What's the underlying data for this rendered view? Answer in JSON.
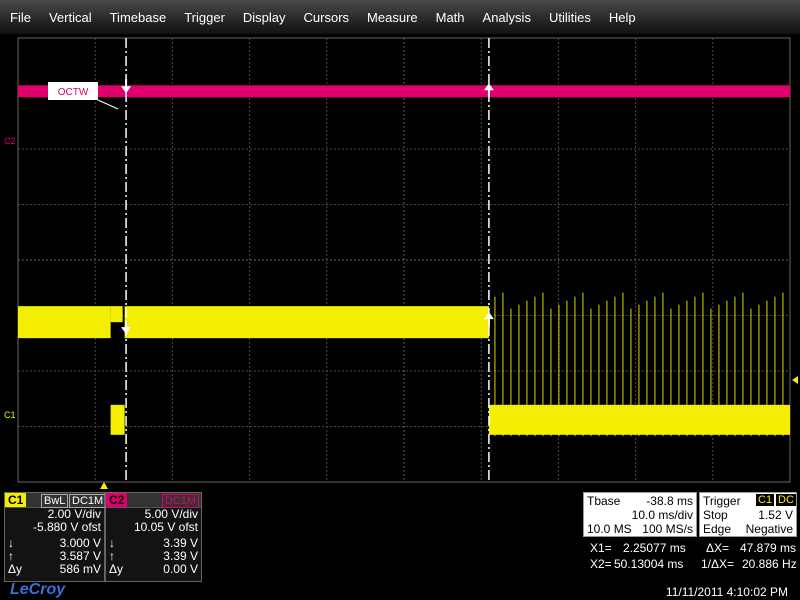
{
  "menu": [
    "File",
    "Vertical",
    "Timebase",
    "Trigger",
    "Display",
    "Cursors",
    "Measure",
    "Math",
    "Analysis",
    "Utilities",
    "Help"
  ],
  "colors": {
    "c1": "#f4ef00",
    "c2": "#e0006c",
    "grid": "#5a5a5a",
    "cursor": "#ffffff"
  },
  "waveform": {
    "annotation": "OCTW",
    "labels": {
      "c1": "C1",
      "c2": "C2"
    },
    "c2_level": 0.12,
    "c1_high": 0.64,
    "c1_low": 0.86,
    "cursor1_x": 0.14,
    "cursor2_x": 0.61,
    "glitch_x": 0.12
  },
  "ch1": {
    "tag": "C1",
    "badge1": "BwL",
    "badge2": "DC1M",
    "vdiv": "2.00 V/div",
    "ofst": "-5.880 V ofst",
    "down_val": "3.000 V",
    "up_val": "3.587 V",
    "dy_label": "Δy",
    "dy_val": "586 mV"
  },
  "ch2": {
    "tag": "C2",
    "badge": "DC1M",
    "vdiv": "5.00 V/div",
    "ofst": "10.05 V ofst",
    "down_val": "3.39 V",
    "up_val": "3.39 V",
    "dy_label": "Δy",
    "dy_val": "0.00 V"
  },
  "timebase": {
    "label": "Tbase",
    "delay": "-38.8 ms",
    "tdiv": "10.0 ms/div",
    "samples": "10.0 MS",
    "rate": "100 MS/s"
  },
  "trigger": {
    "label": "Trigger",
    "tag1": "C1",
    "tag2": "DC",
    "stop": "Stop",
    "level": "1.52 V",
    "mode": "Edge",
    "slope": "Negative"
  },
  "cursors": {
    "x1_label": "X1=",
    "x1": "2.25077 ms",
    "dx_label": "ΔX=",
    "dx": "47.879 ms",
    "x2_label": "X2=",
    "x2": "50.13004 ms",
    "inv_label": "1/ΔX=",
    "inv": "20.886 Hz"
  },
  "brand": "LeCroy",
  "timestamp": "11/11/2011 4:10:02 PM"
}
